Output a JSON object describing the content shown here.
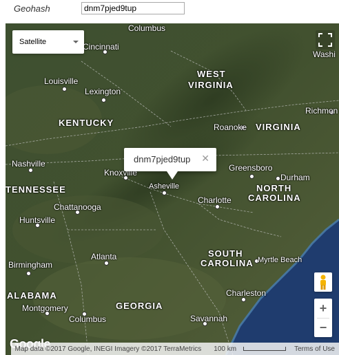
{
  "geohash": {
    "label": "Geohash",
    "value": "dnm7pjed9tup"
  },
  "map": {
    "map_type": "Satellite",
    "info_window": {
      "text": "dnm7pjed9tup",
      "close_glyph": "✕"
    },
    "cities": [
      {
        "id": "columbus-oh",
        "name": "Columbus"
      },
      {
        "id": "cincinnati",
        "name": "Cincinnati"
      },
      {
        "id": "louisville",
        "name": "Louisville"
      },
      {
        "id": "lexington",
        "name": "Lexington"
      },
      {
        "id": "washington",
        "name": "Washi"
      },
      {
        "id": "roanoke",
        "name": "Roanoke"
      },
      {
        "id": "richmond",
        "name": "Richmon"
      },
      {
        "id": "nashville",
        "name": "Nashville"
      },
      {
        "id": "knoxville",
        "name": "Knoxville"
      },
      {
        "id": "asheville",
        "name": "Asheville"
      },
      {
        "id": "greensboro",
        "name": "Greensboro"
      },
      {
        "id": "durham",
        "name": "Durham"
      },
      {
        "id": "charlotte",
        "name": "Charlotte"
      },
      {
        "id": "chattanooga",
        "name": "Chattanooga"
      },
      {
        "id": "huntsville",
        "name": "Huntsville"
      },
      {
        "id": "atlanta",
        "name": "Atlanta"
      },
      {
        "id": "birmingham",
        "name": "Birmingham"
      },
      {
        "id": "montgomery",
        "name": "Montgomery"
      },
      {
        "id": "columbus-ga",
        "name": "Columbus"
      },
      {
        "id": "myrtle-beach",
        "name": "Myrtle Beach"
      },
      {
        "id": "charleston",
        "name": "Charleston"
      },
      {
        "id": "savannah",
        "name": "Savannah"
      }
    ],
    "states": [
      {
        "id": "west-virginia-1",
        "name": "WEST"
      },
      {
        "id": "west-virginia-2",
        "name": "VIRGINIA"
      },
      {
        "id": "kentucky",
        "name": "KENTUCKY"
      },
      {
        "id": "virginia",
        "name": "VIRGINIA"
      },
      {
        "id": "tennessee",
        "name": "TENNESSEE"
      },
      {
        "id": "north-carolina-1",
        "name": "NORTH"
      },
      {
        "id": "north-carolina-2",
        "name": "CAROLINA"
      },
      {
        "id": "south-carolina-1",
        "name": "SOUTH"
      },
      {
        "id": "south-carolina-2",
        "name": "CAROLINA"
      },
      {
        "id": "alabama",
        "name": "ALABAMA"
      },
      {
        "id": "georgia",
        "name": "GEORGIA"
      }
    ],
    "logo": "Google",
    "attribution": "Map data ©2017 Google, INEGI Imagery ©2017 TerraMetrics",
    "scale_label": "100 km",
    "terms": "Terms of Use",
    "zoom_in": "+",
    "zoom_out": "−",
    "colors": {
      "land": "#3c4a2a",
      "ocean": "#1f3c6e",
      "coast": "#4b7fb0",
      "border": "#c8c8c8"
    },
    "icons": [
      "fullscreen-icon",
      "pegman-icon",
      "chevron-down-icon"
    ]
  }
}
